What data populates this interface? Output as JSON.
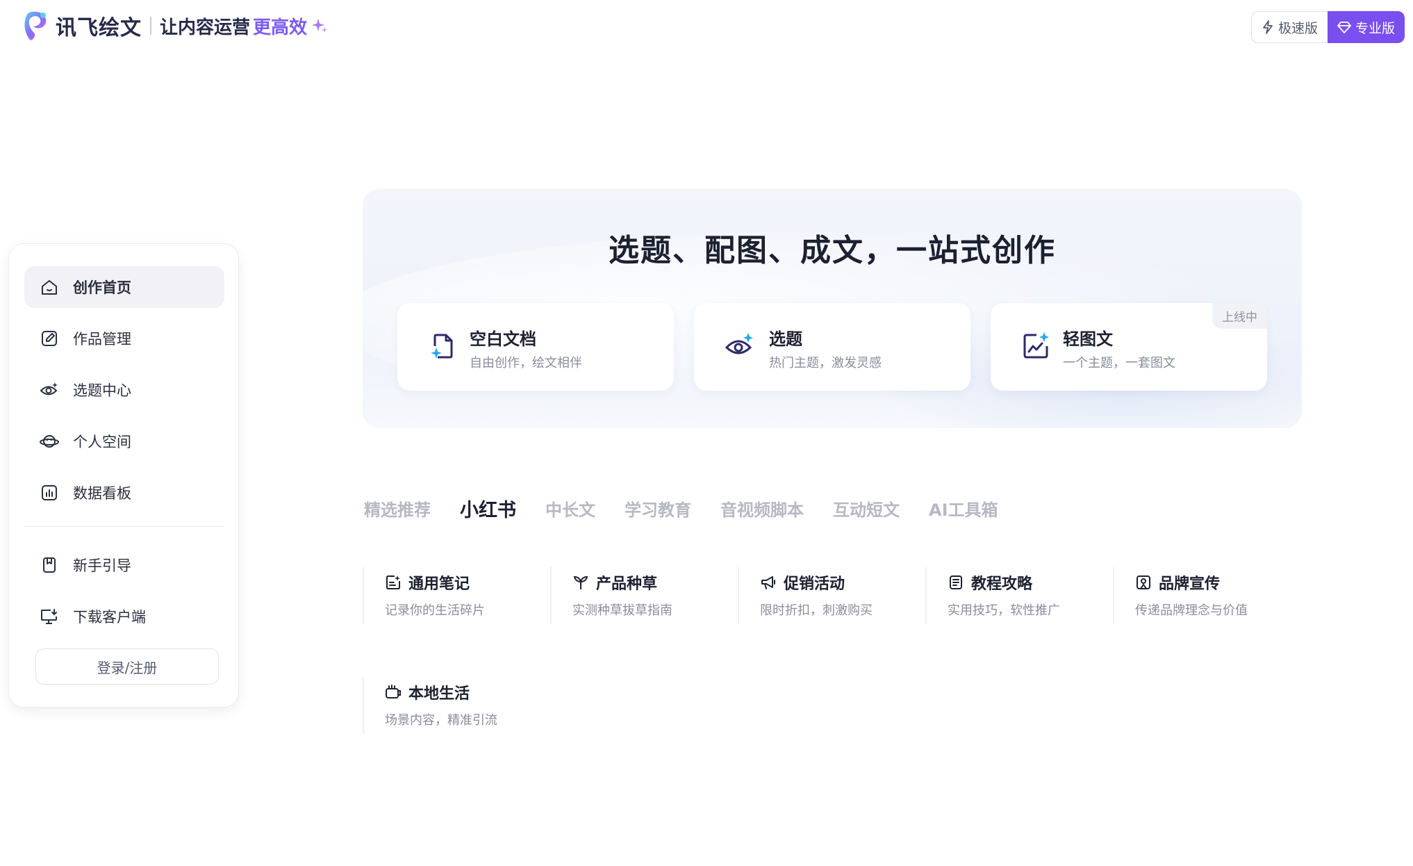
{
  "header": {
    "logo_name": "讯飞绘文",
    "slogan": "让内容运营",
    "slogan_highlight": "更高效",
    "fast_label": "极速版",
    "pro_label": "专业版"
  },
  "colors": {
    "accent": "#7a4ff0",
    "text_primary": "#1d2030",
    "text_secondary": "#8a8d9c",
    "tab_inactive": "#b6b8c3"
  },
  "sidebar": {
    "items": [
      {
        "label": "创作首页",
        "icon": "home-icon",
        "active": true
      },
      {
        "label": "作品管理",
        "icon": "edit-icon"
      },
      {
        "label": "选题中心",
        "icon": "eye-sparkle-icon"
      },
      {
        "label": "个人空间",
        "icon": "planet-icon"
      },
      {
        "label": "数据看板",
        "icon": "bar-chart-icon"
      }
    ],
    "secondary": [
      {
        "label": "新手引导",
        "icon": "bookmark-icon"
      },
      {
        "label": "下载客户端",
        "icon": "monitor-download-icon"
      }
    ],
    "login_label": "登录/注册"
  },
  "hero": {
    "title": "选题、配图、成文，一站式创作",
    "cards": [
      {
        "title": "空白文档",
        "desc": "自由创作，绘文相伴",
        "icon": "blank-doc-icon"
      },
      {
        "title": "选题",
        "desc": "热门主题，激发灵感",
        "icon": "eye-topic-icon"
      },
      {
        "title": "轻图文",
        "desc": "一个主题，一套图文",
        "icon": "image-text-icon",
        "badge": "上线中"
      }
    ]
  },
  "tabs": [
    {
      "label": "精选推荐"
    },
    {
      "label": "小红书",
      "active": true
    },
    {
      "label": "中长文"
    },
    {
      "label": "学习教育"
    },
    {
      "label": "音视频脚本"
    },
    {
      "label": "互动短文"
    },
    {
      "label": "AI工具箱"
    }
  ],
  "templates": [
    {
      "title": "通用笔记",
      "desc": "记录你的生活碎片",
      "icon": "note-icon"
    },
    {
      "title": "产品种草",
      "desc": "实测种草拔草指南",
      "icon": "sprout-icon"
    },
    {
      "title": "促销活动",
      "desc": "限时折扣，刺激购买",
      "icon": "megaphone-icon"
    },
    {
      "title": "教程攻略",
      "desc": "实用技巧，软性推广",
      "icon": "guide-book-icon"
    },
    {
      "title": "品牌宣传",
      "desc": "传递品牌理念与价值",
      "icon": "brand-badge-icon"
    },
    {
      "title": "本地生活",
      "desc": "场景内容，精准引流",
      "icon": "local-life-icon"
    }
  ]
}
